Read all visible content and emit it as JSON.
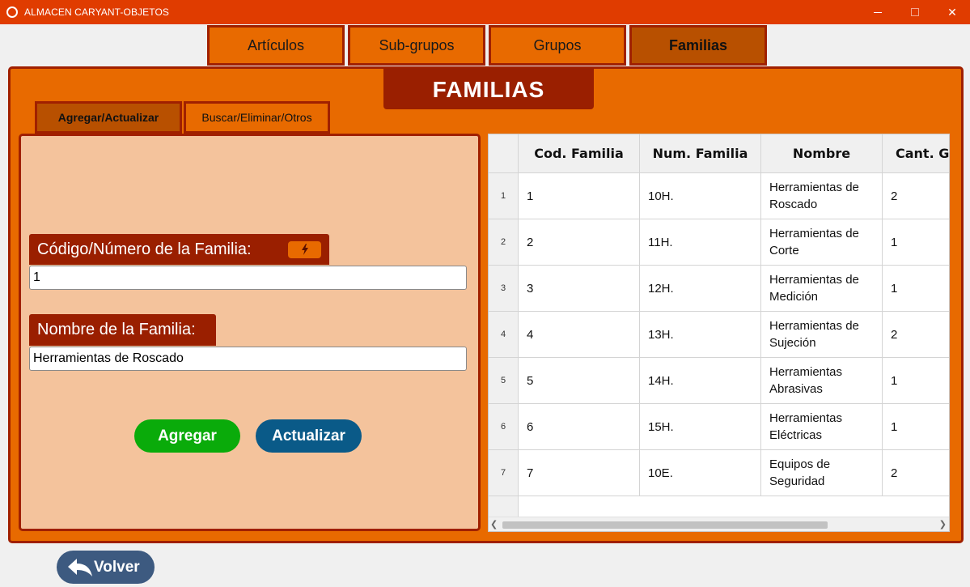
{
  "window": {
    "title": "ALMACEN CARYANT-OBJETOS",
    "minimize_label": "",
    "maximize_label": "",
    "close_label": "✕"
  },
  "top_tabs": [
    {
      "label": "Artículos"
    },
    {
      "label": "Sub-grupos"
    },
    {
      "label": "Grupos"
    },
    {
      "label": "Familias",
      "active": true
    }
  ],
  "header": {
    "title": "FAMILIAS"
  },
  "sub_tabs": [
    {
      "label": "Agregar/Actualizar",
      "active": true
    },
    {
      "label": "Buscar/Eliminar/Otros"
    }
  ],
  "form": {
    "codigo_label": "Código/Número de la Familia:",
    "codigo_value": "1",
    "codigo_action_icon": "lightning-icon",
    "nombre_label": "Nombre de la Familia:",
    "nombre_value": "Herramientas de Roscado",
    "agregar_label": "Agregar",
    "actualizar_label": "Actualizar"
  },
  "table": {
    "columns": [
      "Cod. Familia",
      "Num. Familia",
      "Nombre",
      "Cant. G"
    ],
    "rows": [
      {
        "index": "1",
        "cod": "1",
        "num": "10H.",
        "nombre": "Herramientas de\nRoscado",
        "cant": "2"
      },
      {
        "index": "2",
        "cod": "2",
        "num": "11H.",
        "nombre": "Herramientas de\nCorte",
        "cant": "1"
      },
      {
        "index": "3",
        "cod": "3",
        "num": "12H.",
        "nombre": "Herramientas de\nMedición",
        "cant": "1"
      },
      {
        "index": "4",
        "cod": "4",
        "num": "13H.",
        "nombre": "Herramientas de\nSujeción",
        "cant": "2"
      },
      {
        "index": "5",
        "cod": "5",
        "num": "14H.",
        "nombre": "Herramientas\nAbrasivas",
        "cant": "1"
      },
      {
        "index": "6",
        "cod": "6",
        "num": "15H.",
        "nombre": "Herramientas\nEléctricas",
        "cant": "1"
      },
      {
        "index": "7",
        "cod": "7",
        "num": "10E.",
        "nombre": "Equipos de\nSeguridad",
        "cant": "2"
      }
    ]
  },
  "back_button": {
    "label": "Volver",
    "icon": "back-arrow-icon"
  },
  "colors": {
    "titlebar": "#e03c00",
    "frame": "#e86a00",
    "dark_accent": "#9a1f00",
    "panel": "#f4c39c",
    "agregar": "#0aab0a",
    "actualizar": "#0a5a88",
    "volver": "#3d5a80"
  }
}
